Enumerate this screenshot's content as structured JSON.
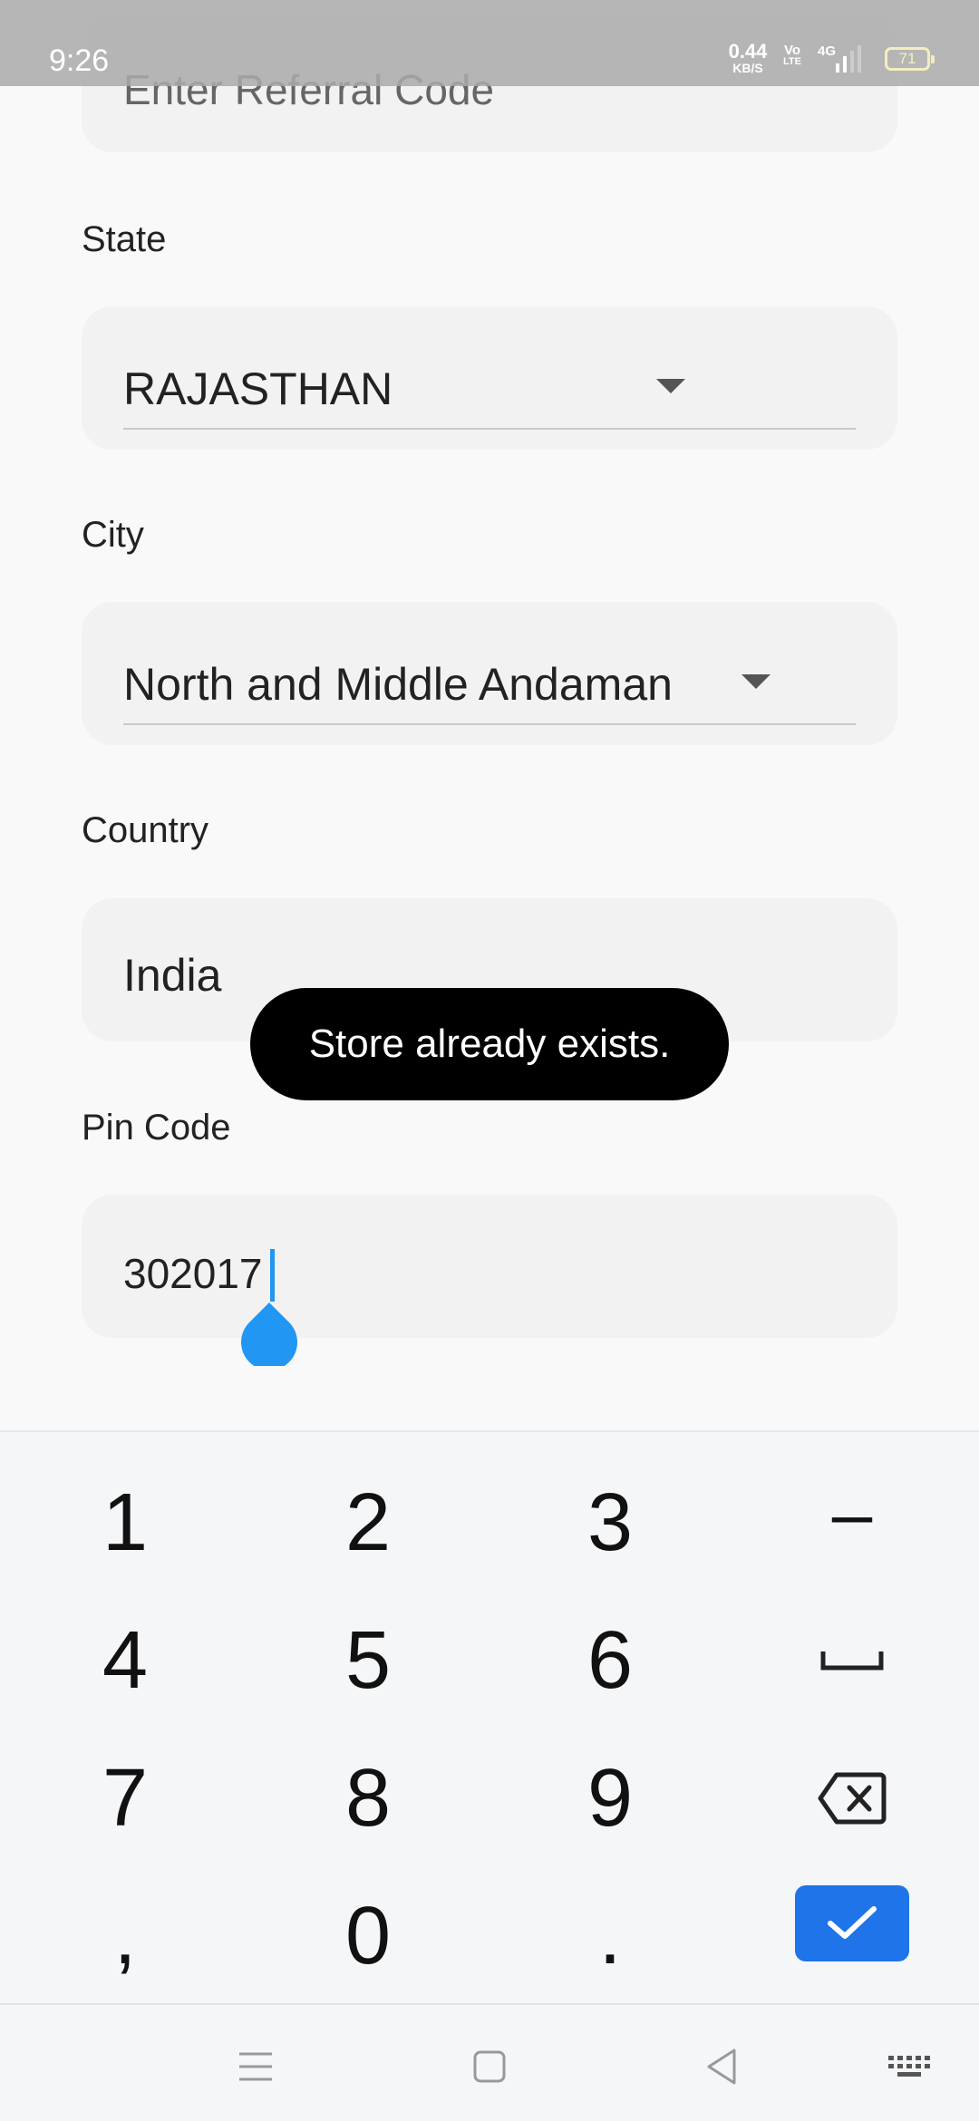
{
  "status_bar": {
    "time": "9:26",
    "speed_value": "0.44",
    "speed_unit": "KB/S",
    "volte_top": "Vo",
    "volte_bottom": "LTE",
    "network": "4G",
    "battery": "71"
  },
  "form": {
    "referral": {
      "placeholder": "Enter Referral Code"
    },
    "state": {
      "label": "State",
      "value": "RAJASTHAN"
    },
    "city": {
      "label": "City",
      "value": "North and Middle Andaman"
    },
    "country": {
      "label": "Country",
      "value": "India"
    },
    "pin_code": {
      "label": "Pin Code",
      "value": "302017"
    }
  },
  "toast": {
    "message": "Store already exists."
  },
  "keyboard": {
    "rows": [
      [
        "1",
        "2",
        "3",
        "–"
      ],
      [
        "4",
        "5",
        "6",
        "space-icon"
      ],
      [
        "7",
        "8",
        "9",
        "backspace-icon"
      ],
      [
        ",",
        "0",
        ".",
        "done-check-icon"
      ]
    ],
    "accent_color": "#1e74e8"
  },
  "nav_bar": {
    "items": [
      "menu-icon",
      "home-square-icon",
      "back-triangle-icon",
      "keyboard-icon"
    ]
  },
  "colors": {
    "cursor": "#2196f3",
    "toast_bg": "#000000",
    "field_bg": "#f2f2f2"
  }
}
